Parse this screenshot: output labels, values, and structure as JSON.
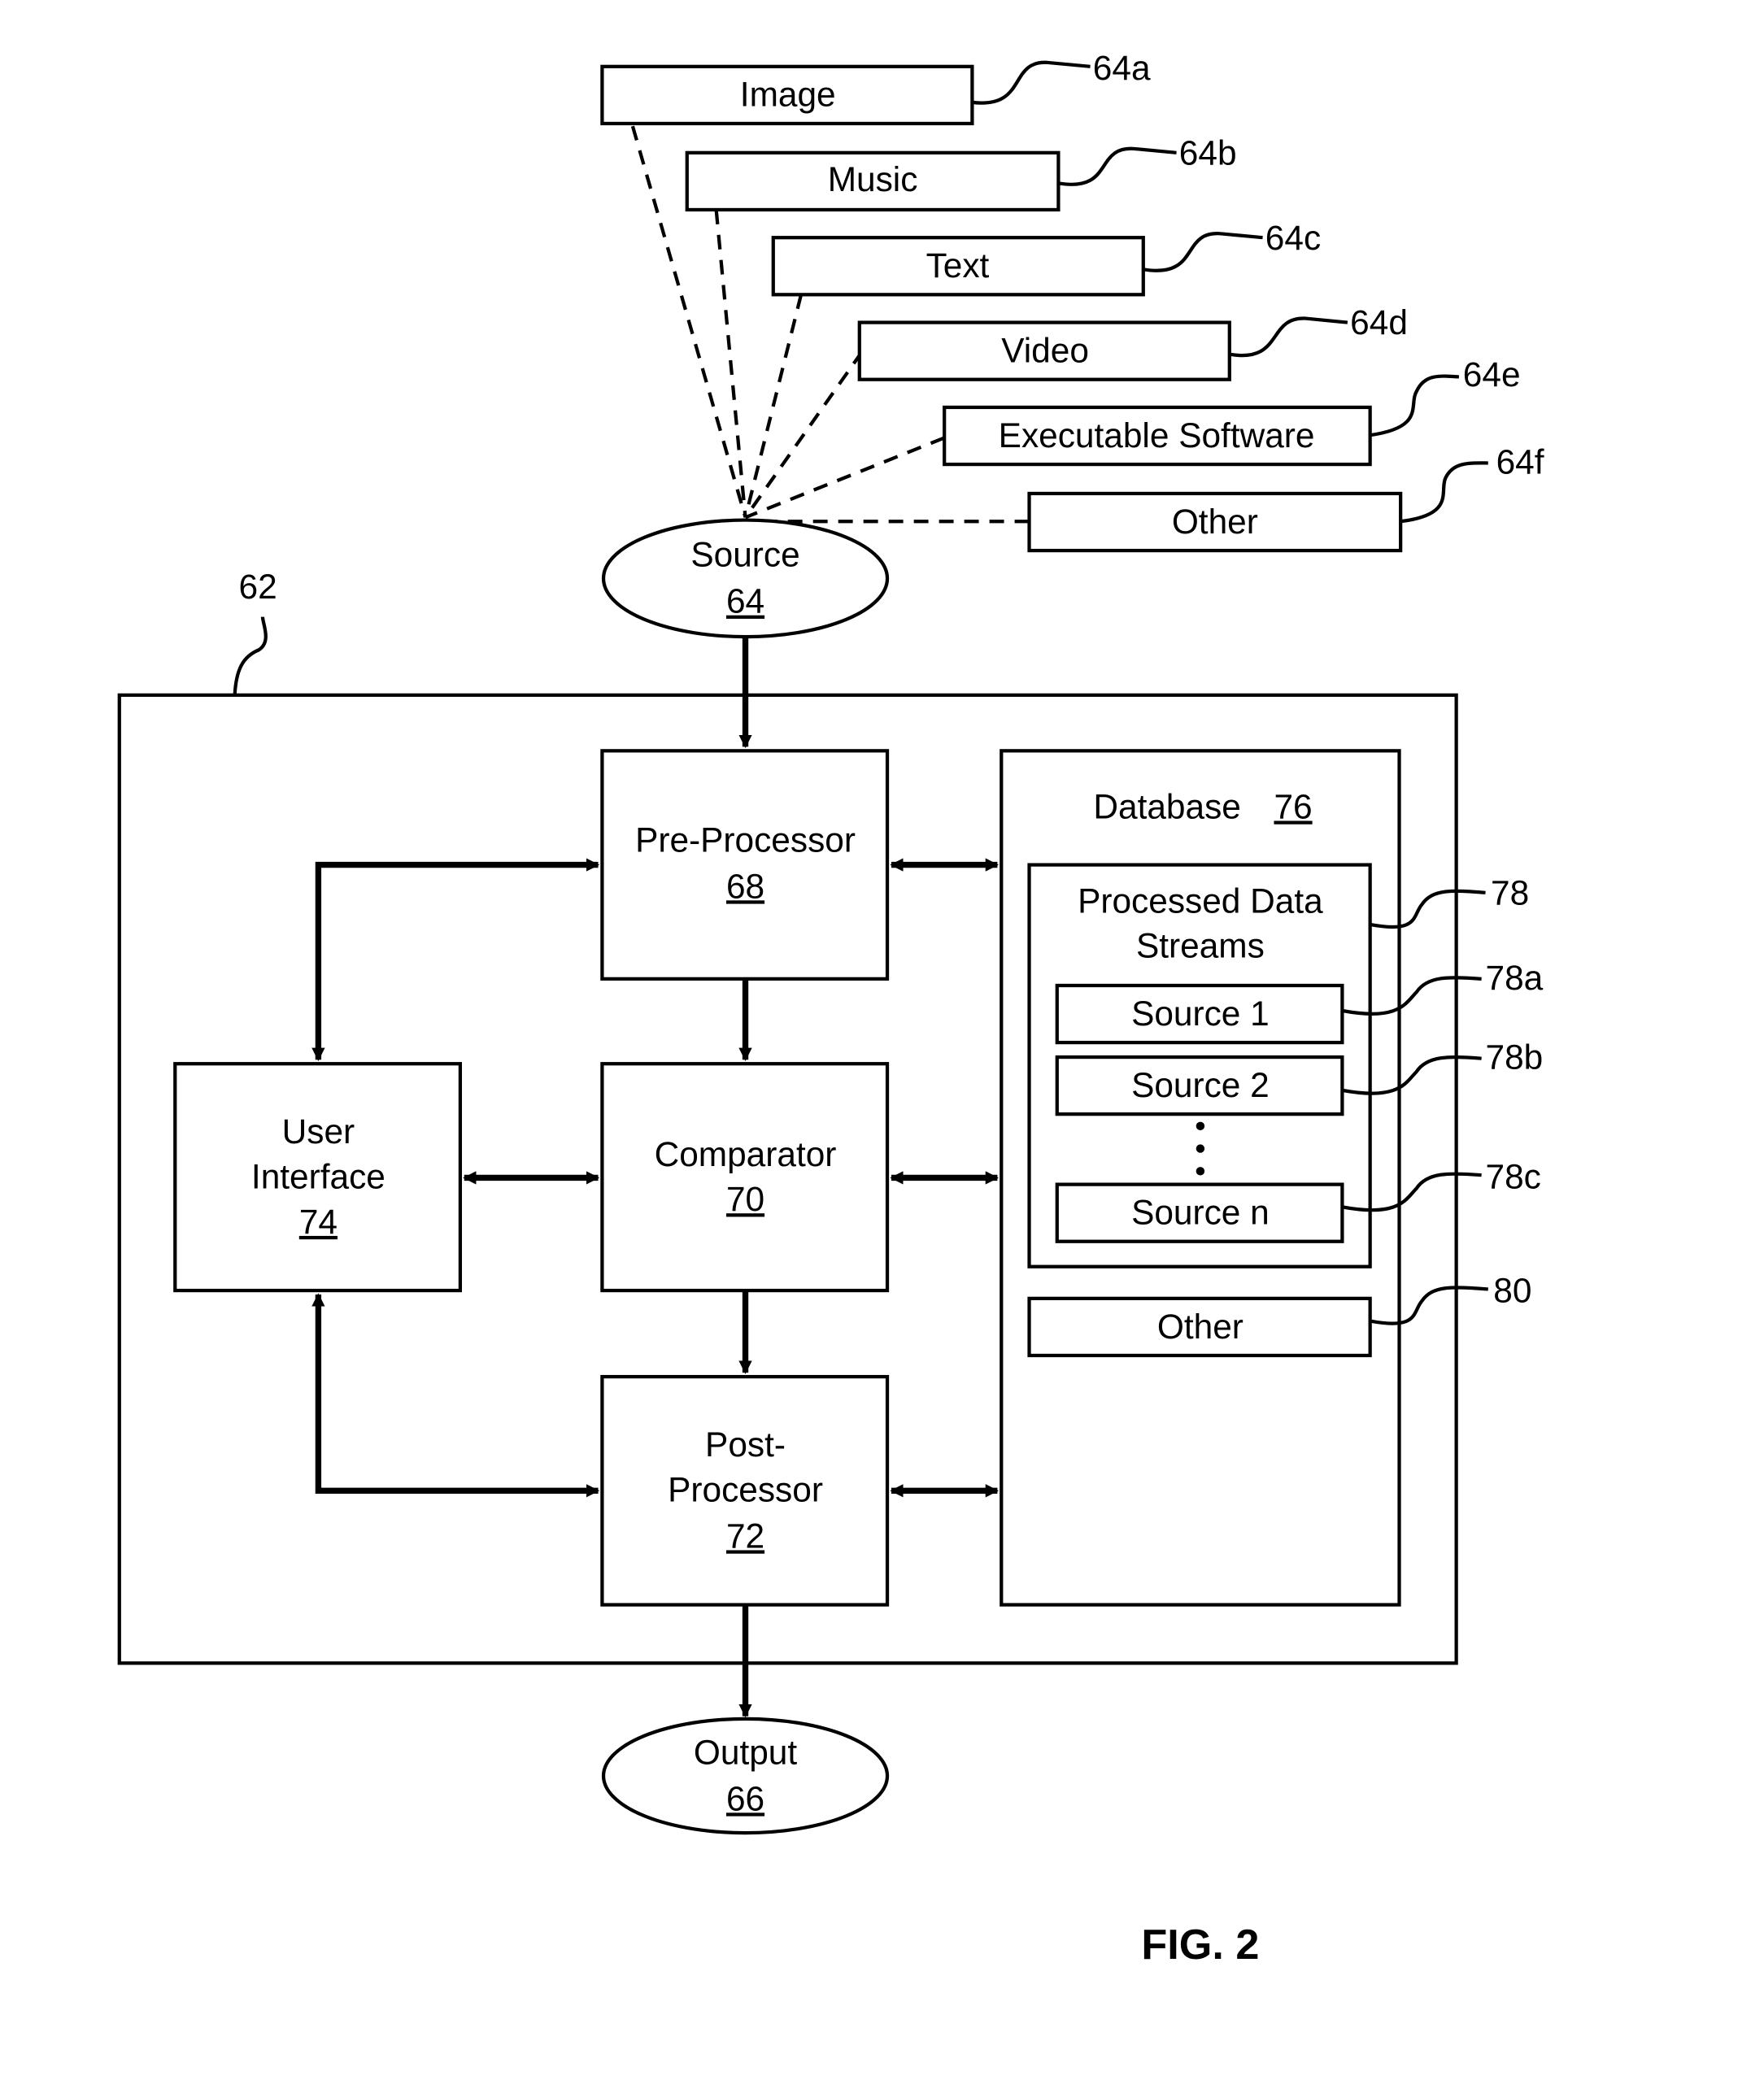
{
  "figure": {
    "label": "FIG. 2",
    "system_ref": "62"
  },
  "source": {
    "label": "Source",
    "ref": "64",
    "types": [
      {
        "label": "Image",
        "ref": "64a"
      },
      {
        "label": "Music",
        "ref": "64b"
      },
      {
        "label": "Text",
        "ref": "64c"
      },
      {
        "label": "Video",
        "ref": "64d"
      },
      {
        "label": "Executable Software",
        "ref": "64e"
      },
      {
        "label": "Other",
        "ref": "64f"
      }
    ]
  },
  "pre_processor": {
    "label": "Pre-Processor",
    "ref": "68"
  },
  "comparator": {
    "label": "Comparator",
    "ref": "70"
  },
  "post_processor": {
    "label_line1": "Post-",
    "label_line2": "Processor",
    "ref": "72"
  },
  "user_interface": {
    "label_line1": "User",
    "label_line2": "Interface",
    "ref": "74"
  },
  "database": {
    "label": "Database",
    "ref": "76",
    "processed": {
      "label_line1": "Processed Data",
      "label_line2": "Streams",
      "ref": "78",
      "sources": [
        {
          "label": "Source 1",
          "ref": "78a"
        },
        {
          "label": "Source 2",
          "ref": "78b"
        },
        {
          "label": "Source n",
          "ref": "78c"
        }
      ],
      "ellipsis": "⋮"
    },
    "other": {
      "label": "Other",
      "ref": "80"
    }
  },
  "output": {
    "label": "Output",
    "ref": "66"
  }
}
